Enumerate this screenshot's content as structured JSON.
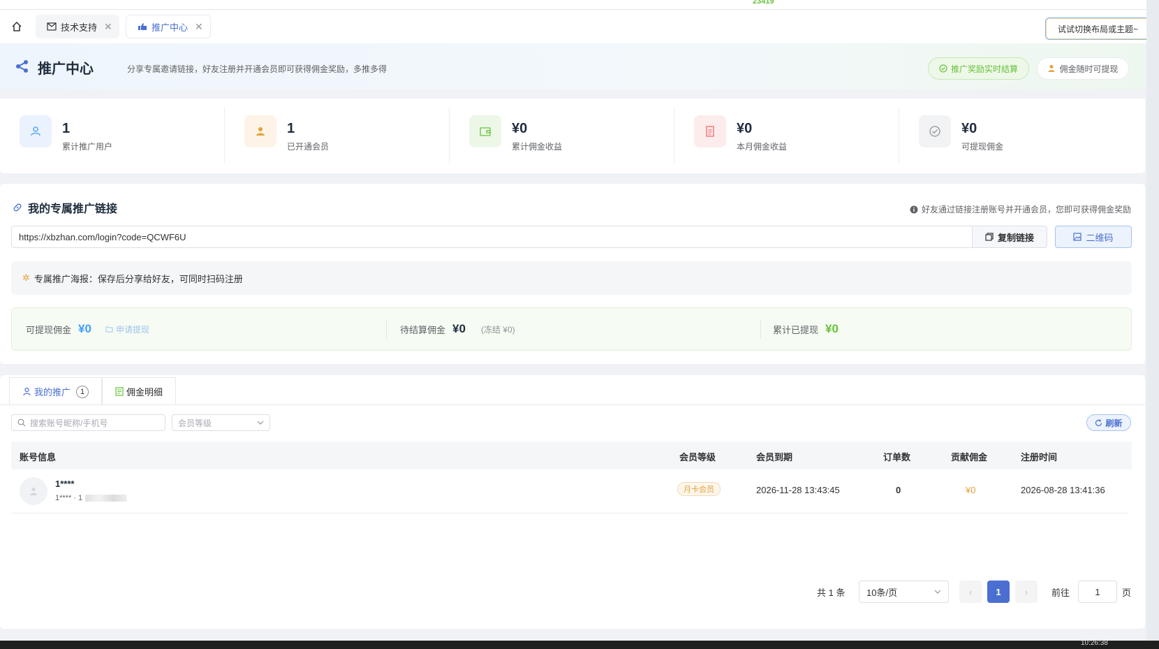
{
  "top": {
    "clipped_number": "23419"
  },
  "tabs": [
    {
      "label": "技术支持"
    },
    {
      "label": "推广中心"
    }
  ],
  "tip_bubble": "试试切换布局或主题~",
  "banner": {
    "title": "推广中心",
    "subtitle": "分享专属邀请链接，好友注册并开通会员即可获得佣金奖励，多推多得",
    "pill_green": "推广奖励实时结算",
    "pill_orange": "佣金随时可提现"
  },
  "stats": [
    {
      "value": "1",
      "label": "累计推广用户",
      "icon": "user-icon"
    },
    {
      "value": "1",
      "label": "已开通会员",
      "icon": "member-icon"
    },
    {
      "value": "¥0",
      "label": "累计佣金收益",
      "icon": "wallet-icon"
    },
    {
      "value": "¥0",
      "label": "本月佣金收益",
      "icon": "document-icon"
    },
    {
      "value": "¥0",
      "label": "可提现佣金",
      "icon": "check-circle-icon"
    }
  ],
  "link_section": {
    "title": "我的专属推广链接",
    "hint": "好友通过链接注册账号并开通会员，您即可获得佣金奖励",
    "url": "https://xbzhan.com/login?code=QCWF6U",
    "copy_label": "复制链接",
    "qr_label": "二维码",
    "poster_text": "专属推广海报：保存后分享给好友，可同时扫码注册"
  },
  "balance": {
    "withdrawable_label": "可提现佣金",
    "withdrawable_value": "¥0",
    "apply_label": "申请提现",
    "pending_label": "待结算佣金",
    "pending_value": "¥0",
    "frozen_text": "(冻结 ¥0)",
    "withdrawn_label": "累计已提现",
    "withdrawn_value": "¥0"
  },
  "list": {
    "tab_my": "我的推广",
    "tab_my_count": "1",
    "tab_commission": "佣金明细",
    "search_placeholder": "搜索账号昵称/手机号",
    "level_placeholder": "会员等级",
    "refresh_label": "刷新",
    "columns": [
      "账号信息",
      "会员等级",
      "会员到期",
      "订单数",
      "贡献佣金",
      "注册时间"
    ],
    "rows": [
      {
        "name": "1****",
        "sub": "1**** · 1",
        "level": "月卡会员",
        "expire": "2026-11-28 13:43:45",
        "orders": "0",
        "commission": "¥0",
        "registered": "2026-08-28 13:41:36"
      }
    ]
  },
  "pagination": {
    "total": "共 1 条",
    "page_size": "10条/页",
    "current": "1",
    "goto_label": "前往",
    "goto_value": "1",
    "page_suffix": "页"
  },
  "taskbar": {
    "clock": "10:26:38"
  },
  "colors": {
    "accent": "#4a6fd1",
    "green": "#67c23a",
    "orange": "#e6a23c",
    "blue": "#409eff"
  }
}
